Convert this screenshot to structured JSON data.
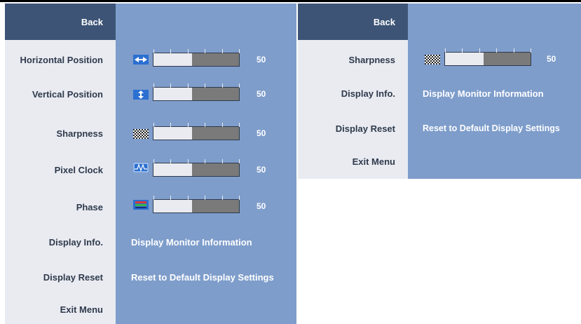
{
  "left_panel": {
    "back_label": "Back",
    "items": [
      {
        "label": "Horizontal Position",
        "kind": "slider",
        "value": 50,
        "icon": "horizontal-position-icon"
      },
      {
        "label": "Vertical Position",
        "kind": "slider",
        "value": 50,
        "icon": "vertical-position-icon"
      },
      {
        "label": "Sharpness",
        "kind": "slider",
        "value": 50,
        "icon": "sharpness-icon"
      },
      {
        "label": "Pixel Clock",
        "kind": "slider",
        "value": 50,
        "icon": "pixel-clock-icon"
      },
      {
        "label": "Phase",
        "kind": "slider",
        "value": 50,
        "icon": "phase-icon"
      },
      {
        "label": "Display Info.",
        "kind": "text",
        "text": "Display Monitor Information"
      },
      {
        "label": "Display Reset",
        "kind": "text",
        "text": "Reset to Default Display Settings"
      },
      {
        "label": "Exit Menu",
        "kind": "none"
      }
    ]
  },
  "right_panel": {
    "back_label": "Back",
    "items": [
      {
        "label": "Sharpness",
        "kind": "slider",
        "value": 50,
        "icon": "sharpness-icon"
      },
      {
        "label": "Display Info.",
        "kind": "text",
        "text": "Display Monitor Information"
      },
      {
        "label": "Display Reset",
        "kind": "text",
        "text": "Reset to Default Display Settings"
      },
      {
        "label": "Exit Menu",
        "kind": "none"
      }
    ]
  },
  "slider_fill_fraction": 0.5,
  "colors": {
    "menu_background": "#e9ebf1",
    "value_background": "#7e9dcb",
    "back_button": "#3d5476",
    "label_text": "#2f3a4c",
    "value_text": "#ffffff",
    "slider_empty": "#7a7a7a"
  }
}
